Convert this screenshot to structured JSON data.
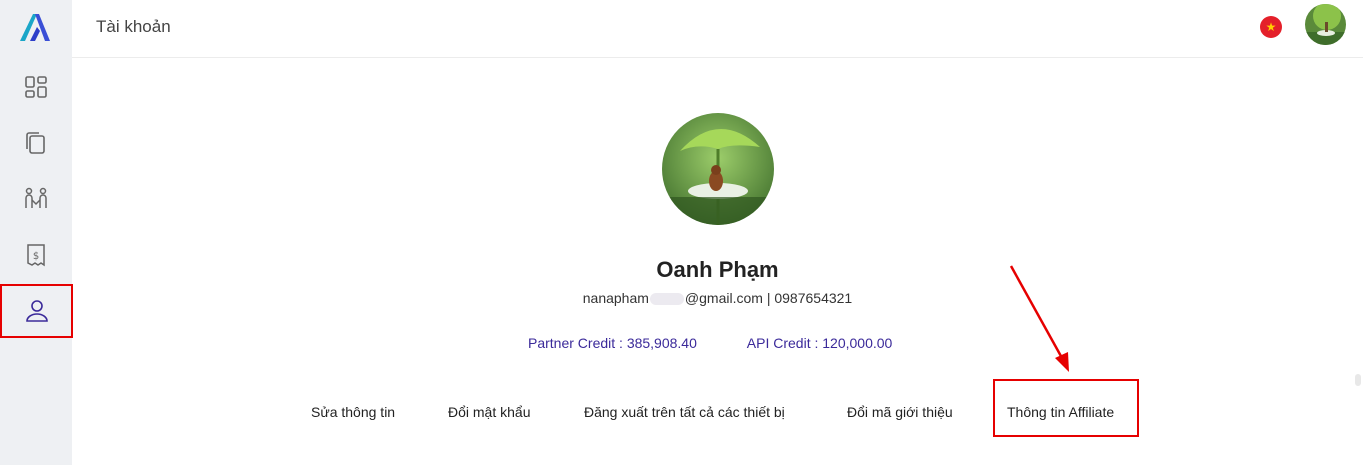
{
  "header": {
    "title": "Tài khoản"
  },
  "sidebar": {
    "items": [
      {
        "name": "dashboard-icon"
      },
      {
        "name": "copy-icon"
      },
      {
        "name": "users-icon"
      },
      {
        "name": "billing-icon"
      },
      {
        "name": "user-icon",
        "active": true
      }
    ]
  },
  "profile": {
    "name": "Oanh Phạm",
    "email_prefix": "nanapham",
    "email_suffix": "@gmail.com",
    "separator": " | ",
    "phone": "0987654321",
    "partner_credit": "Partner Credit : 385,908.40",
    "api_credit": "API Credit : 120,000.00"
  },
  "actions": {
    "edit": "Sửa thông tin",
    "change_password": "Đổi mật khẩu",
    "logout_all": "Đăng xuất trên tất cả các thiết bị",
    "change_ref_code": "Đổi mã giới thiệu",
    "affiliate_info": "Thông tin Affiliate"
  },
  "colors": {
    "accent": "#3b2a9a",
    "highlight": "#e60000",
    "sidebar_bg": "#eef0f3"
  }
}
